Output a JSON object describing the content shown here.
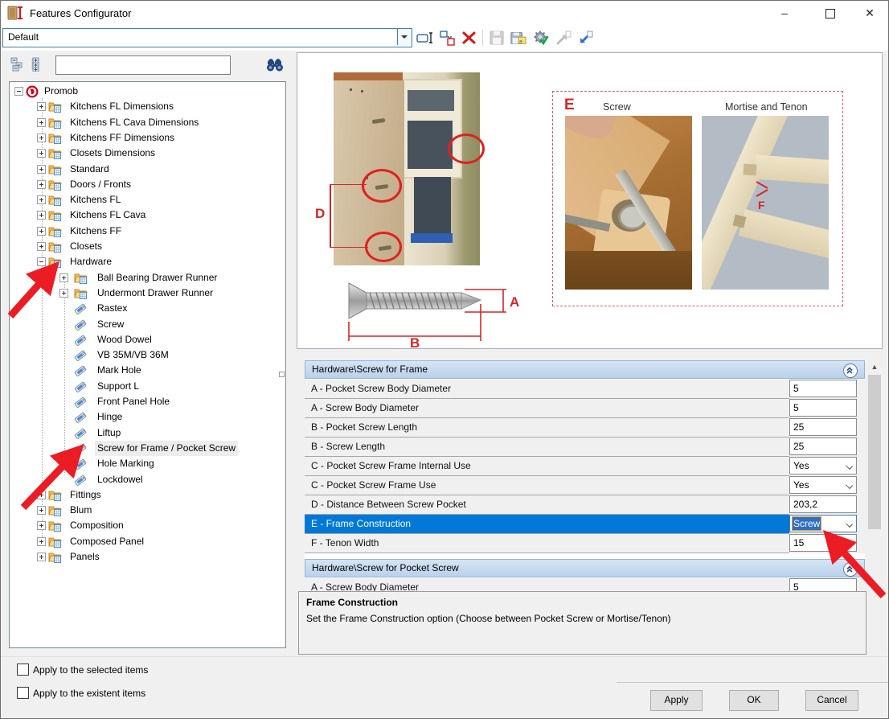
{
  "window": {
    "title": "Features Configurator",
    "minimize": "–",
    "close": "✕"
  },
  "toolbar": {
    "profile_value": "Default",
    "icons": [
      {
        "name": "rename-profile-icon"
      },
      {
        "name": "duplicate-profile-icon"
      },
      {
        "name": "delete-profile-icon"
      },
      {
        "name": "save-icon"
      },
      {
        "name": "save-configuration-icon"
      },
      {
        "name": "apply-configuration-icon"
      },
      {
        "name": "export-icon"
      },
      {
        "name": "import-icon"
      }
    ]
  },
  "left_panel": {
    "search_value": "",
    "tree": [
      {
        "label": "Promob",
        "level": 0,
        "icon": "promob",
        "expander": "minus"
      },
      {
        "label": "Kitchens FL Dimensions",
        "level": 1,
        "icon": "folder",
        "expander": "plus"
      },
      {
        "label": "Kitchens FL Cava Dimensions",
        "level": 1,
        "icon": "folder",
        "expander": "plus"
      },
      {
        "label": "Kitchens FF Dimensions",
        "level": 1,
        "icon": "folder",
        "expander": "plus"
      },
      {
        "label": "Closets Dimensions",
        "level": 1,
        "icon": "folder",
        "expander": "plus"
      },
      {
        "label": "Standard",
        "level": 1,
        "icon": "folder",
        "expander": "plus"
      },
      {
        "label": "Doors / Fronts",
        "level": 1,
        "icon": "folder",
        "expander": "plus"
      },
      {
        "label": "Kitchens FL",
        "level": 1,
        "icon": "folder",
        "expander": "plus"
      },
      {
        "label": "Kitchens FL Cava",
        "level": 1,
        "icon": "folder",
        "expander": "plus"
      },
      {
        "label": "Kitchens FF",
        "level": 1,
        "icon": "folder",
        "expander": "plus"
      },
      {
        "label": "Closets",
        "level": 1,
        "icon": "folder",
        "expander": "plus"
      },
      {
        "label": "Hardware",
        "level": 1,
        "icon": "folder",
        "expander": "minus"
      },
      {
        "label": "Ball Bearing Drawer Runner",
        "level": 2,
        "icon": "folder",
        "expander": "plus"
      },
      {
        "label": "Undermont Drawer Runner",
        "level": 2,
        "icon": "folder",
        "expander": "plus"
      },
      {
        "label": "Rastex",
        "level": 2,
        "icon": "tag"
      },
      {
        "label": "Screw",
        "level": 2,
        "icon": "tag"
      },
      {
        "label": "Wood Dowel",
        "level": 2,
        "icon": "tag"
      },
      {
        "label": "VB 35M/VB 36M",
        "level": 2,
        "icon": "tag"
      },
      {
        "label": "Mark Hole",
        "level": 2,
        "icon": "tag"
      },
      {
        "label": "Support L",
        "level": 2,
        "icon": "tag"
      },
      {
        "label": "Front Panel Hole",
        "level": 2,
        "icon": "tag"
      },
      {
        "label": "Hinge",
        "level": 2,
        "icon": "tag"
      },
      {
        "label": "Liftup",
        "level": 2,
        "icon": "tag"
      },
      {
        "label": "Screw for Frame / Pocket Screw",
        "level": 2,
        "icon": "tag",
        "selected": true
      },
      {
        "label": "Hole Marking",
        "level": 2,
        "icon": "tag"
      },
      {
        "label": "Lockdowel",
        "level": 2,
        "icon": "tag"
      },
      {
        "label": "Fittings",
        "level": 1,
        "icon": "folder",
        "expander": "plus"
      },
      {
        "label": "Blum",
        "level": 1,
        "icon": "folder",
        "expander": "plus"
      },
      {
        "label": "Composition",
        "level": 1,
        "icon": "folder",
        "expander": "plus"
      },
      {
        "label": "Composed Panel",
        "level": 1,
        "icon": "folder",
        "expander": "plus"
      },
      {
        "label": "Panels",
        "level": 1,
        "icon": "folder",
        "expander": "plus"
      }
    ]
  },
  "preview": {
    "label_d": "D",
    "label_a": "A",
    "label_b": "B",
    "label_e": "E",
    "label_f": "F",
    "label_screw": "Screw",
    "label_mortise": "Mortise and Tenon"
  },
  "property_grid": {
    "sections": [
      {
        "title": "Hardware\\Screw for Frame",
        "rows": [
          {
            "label": "A - Pocket Screw Body Diameter",
            "value": "5",
            "type": "text"
          },
          {
            "label": "A - Screw Body Diameter",
            "value": "5",
            "type": "text"
          },
          {
            "label": "B - Pocket Screw Length",
            "value": "25",
            "type": "text"
          },
          {
            "label": "B - Screw Length",
            "value": "25",
            "type": "text"
          },
          {
            "label": "C - Pocket Screw Frame Internal Use",
            "value": "Yes",
            "type": "select"
          },
          {
            "label": "C - Pocket Screw Frame Use",
            "value": "Yes",
            "type": "select"
          },
          {
            "label": "D - Distance Between Screw Pocket",
            "value": "203,2",
            "type": "text"
          },
          {
            "label": "E - Frame Construction",
            "value": "Screw",
            "type": "select",
            "selected": true
          },
          {
            "label": "F - Tenon Width",
            "value": "15",
            "type": "text"
          }
        ]
      },
      {
        "title": "Hardware\\Screw for Pocket Screw",
        "rows": [
          {
            "label": "A - Screw Body Diameter",
            "value": "5",
            "type": "text",
            "partial": true
          }
        ]
      }
    ]
  },
  "description": {
    "title": "Frame Construction",
    "body": "Set the Frame Construction option (Choose between Pocket Screw or Mortise/Tenon)"
  },
  "footer": {
    "checkbox_selected": "Apply to the selected items",
    "checkbox_existent": "Apply to the existent items",
    "apply_label": "Apply",
    "ok_label": "OK",
    "cancel_label": "Cancel"
  },
  "colors": {
    "selection_blue": "#0078d7",
    "section_header_blue": "#bcd4ee",
    "annotation_red": "#e01b24"
  }
}
